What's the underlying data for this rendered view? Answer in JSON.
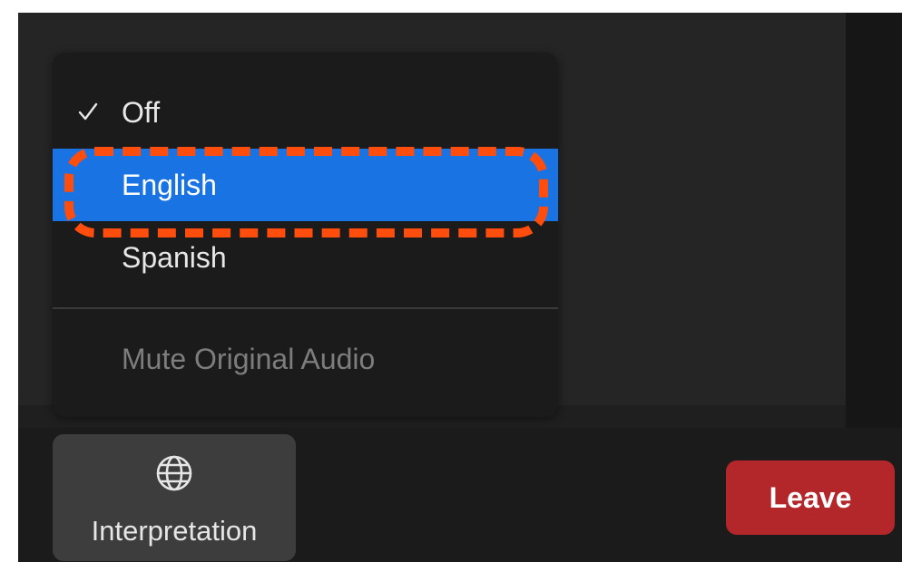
{
  "interpretation_menu": {
    "items": [
      {
        "label": "Off",
        "checked": true,
        "highlighted": false
      },
      {
        "label": "English",
        "checked": false,
        "highlighted": true
      },
      {
        "label": "Spanish",
        "checked": false,
        "highlighted": false
      }
    ],
    "mute_label": "Mute Original Audio",
    "highlight_color": "#1a73e2"
  },
  "annotation": {
    "color": "#ff4d0d",
    "target": "English"
  },
  "toolbar": {
    "interpretation_label": "Interpretation",
    "interpretation_icon": "globe-icon",
    "leave_label": "Leave",
    "leave_color": "#b3272b"
  }
}
